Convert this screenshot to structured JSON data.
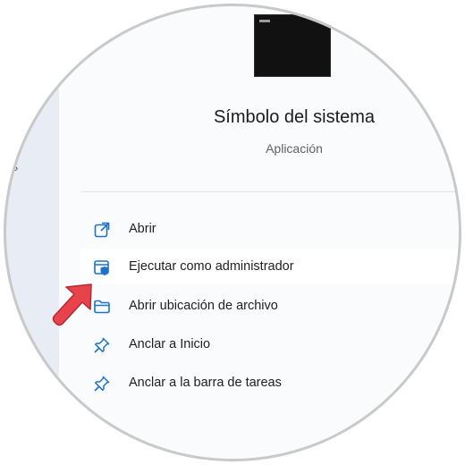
{
  "app": {
    "name": "Símbolo del sistema",
    "type": "Aplicación",
    "icon": "command-prompt-thumbnail"
  },
  "actions": [
    {
      "label": "Abrir",
      "icon": "open-external-icon"
    },
    {
      "label": "Ejecutar como administrador",
      "icon": "admin-shield-icon",
      "highlighted": true
    },
    {
      "label": "Abrir ubicación de archivo",
      "icon": "folder-icon"
    },
    {
      "label": "Anclar a Inicio",
      "icon": "pin-icon"
    },
    {
      "label": "Anclar a la barra de tareas",
      "icon": "pin-icon"
    }
  ],
  "colors": {
    "accent": "#1a73c9",
    "pointer": "#e8434b"
  }
}
